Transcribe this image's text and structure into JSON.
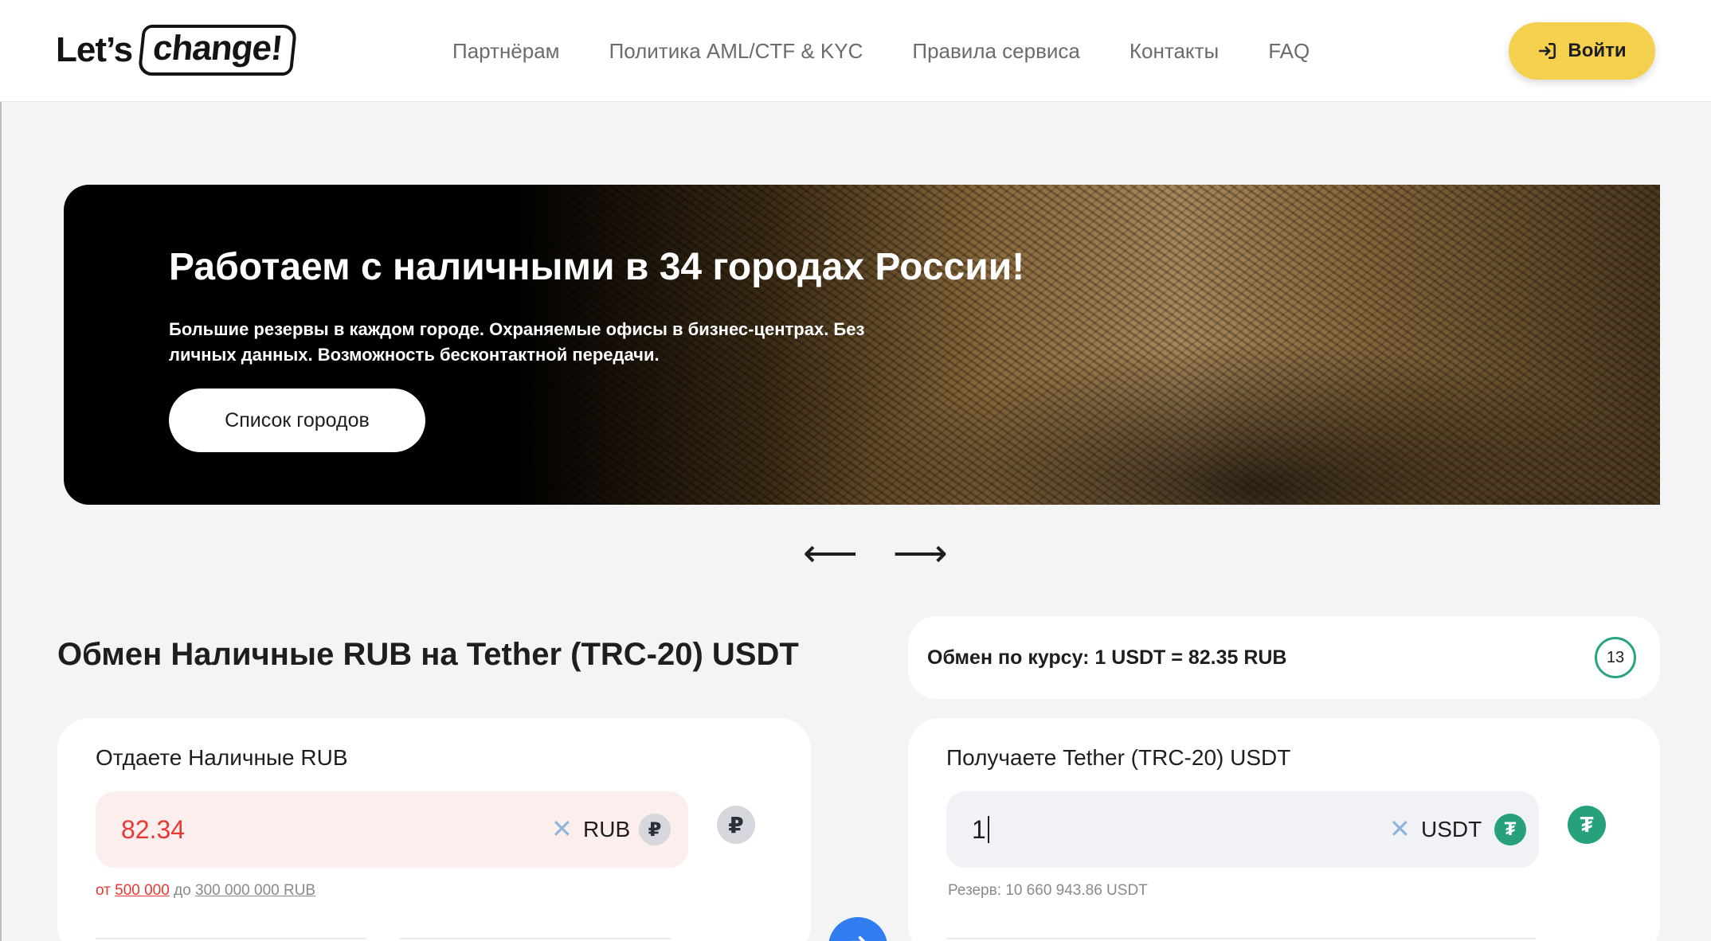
{
  "header": {
    "logo_part1": "Let’s",
    "logo_part2": "change!",
    "nav": [
      "Партнёрам",
      "Политика AML/CTF & KYC",
      "Правила сервиса",
      "Контакты",
      "FAQ"
    ],
    "login_label": "Войти"
  },
  "banner": {
    "title": "Работаем с наличными в 34 городах России!",
    "text": "Большие резервы в каждом городе. Охраняемые офисы в бизнес-центрах. Без личных данных. Возможность бесконтактной передачи.",
    "button_label": "Список городов",
    "prev_arrow": "⟵",
    "next_arrow": "⟶"
  },
  "exchange": {
    "title": "Обмен Наличные RUB на Tether (TRC-20) USDT",
    "rate_text": "Обмен по курсу: 1 USDT = 82.35 RUB",
    "timer": "13"
  },
  "give": {
    "label": "Отдаете Наличные RUB",
    "value": "82.34",
    "currency": "RUB",
    "icon_symbol": "₽",
    "limits_from": "от",
    "limits_min": "500 000",
    "limits_to": "до",
    "limits_max": "300 000 000 RUB"
  },
  "receive": {
    "label": "Получаете Tether (TRC-20) USDT",
    "value": "1",
    "currency": "USDT",
    "icon_symbol": "₮",
    "reserve": "Резерв: 10 660 943.86 USDT"
  },
  "colors": {
    "accent_yellow": "#f5d04f",
    "error_red": "#e53935",
    "tether_green": "#26a17b",
    "swap_blue": "#2f7df0"
  }
}
